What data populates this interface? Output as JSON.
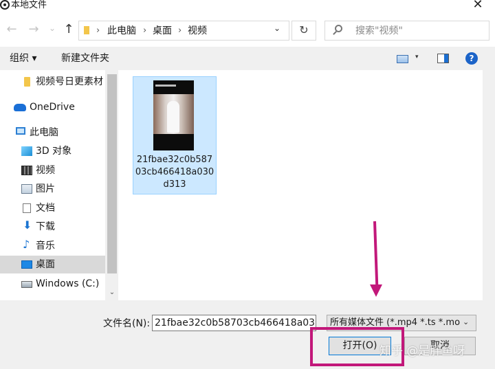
{
  "window": {
    "title": "本地文件",
    "close_glyph": "✕"
  },
  "nav": {
    "back_glyph": "←",
    "forward_glyph": "→",
    "recent_glyph": "⌄",
    "up_glyph": "↑",
    "breadcrumb": [
      "此电脑",
      "桌面",
      "视频"
    ],
    "separator": "›",
    "dropdown_glyph": "⌄",
    "refresh_glyph": "↻",
    "search_placeholder": "搜索\"视频\""
  },
  "toolbar": {
    "organize_label": "组织 ▾",
    "new_folder_label": "新建文件夹",
    "view_drop_glyph": "▾",
    "help_glyph": "?"
  },
  "sidebar": {
    "items": [
      {
        "label": "视频号日更素材",
        "icon": "folder-icon"
      },
      {
        "label": "OneDrive",
        "icon": "onedrive-cloud-icon"
      },
      {
        "label": "此电脑",
        "icon": "computer-icon"
      },
      {
        "label": "3D 对象",
        "icon": "3d-objects-icon"
      },
      {
        "label": "视频",
        "icon": "video-folder-icon"
      },
      {
        "label": "图片",
        "icon": "pictures-icon"
      },
      {
        "label": "文档",
        "icon": "documents-icon"
      },
      {
        "label": "下载",
        "icon": "download-icon"
      },
      {
        "label": "音乐",
        "icon": "music-icon"
      },
      {
        "label": "桌面",
        "icon": "desktop-icon",
        "selected": true
      },
      {
        "label": "Windows (C:)",
        "icon": "drive-icon"
      }
    ],
    "scroll_down_glyph": "⌄",
    "download_glyph": "⬇",
    "music_glyph": "♪"
  },
  "files": [
    {
      "name": "21fbae32c0b58703cb466418a030d313",
      "selected": true
    }
  ],
  "footer": {
    "filename_label": "文件名(N):",
    "filename_value": "21fbae32c0b58703cb466418a03",
    "filetype_value": "所有媒体文件 (*.mp4 *.ts *.mo",
    "filetype_chevron": "⌄",
    "open_label": "打开(O)",
    "cancel_label": "取消"
  },
  "watermark": "知乎 @是胖鱼呀",
  "colors": {
    "annotation": "#c2187a",
    "selection_fill": "#cce8ff",
    "accent": "#0078d7"
  }
}
